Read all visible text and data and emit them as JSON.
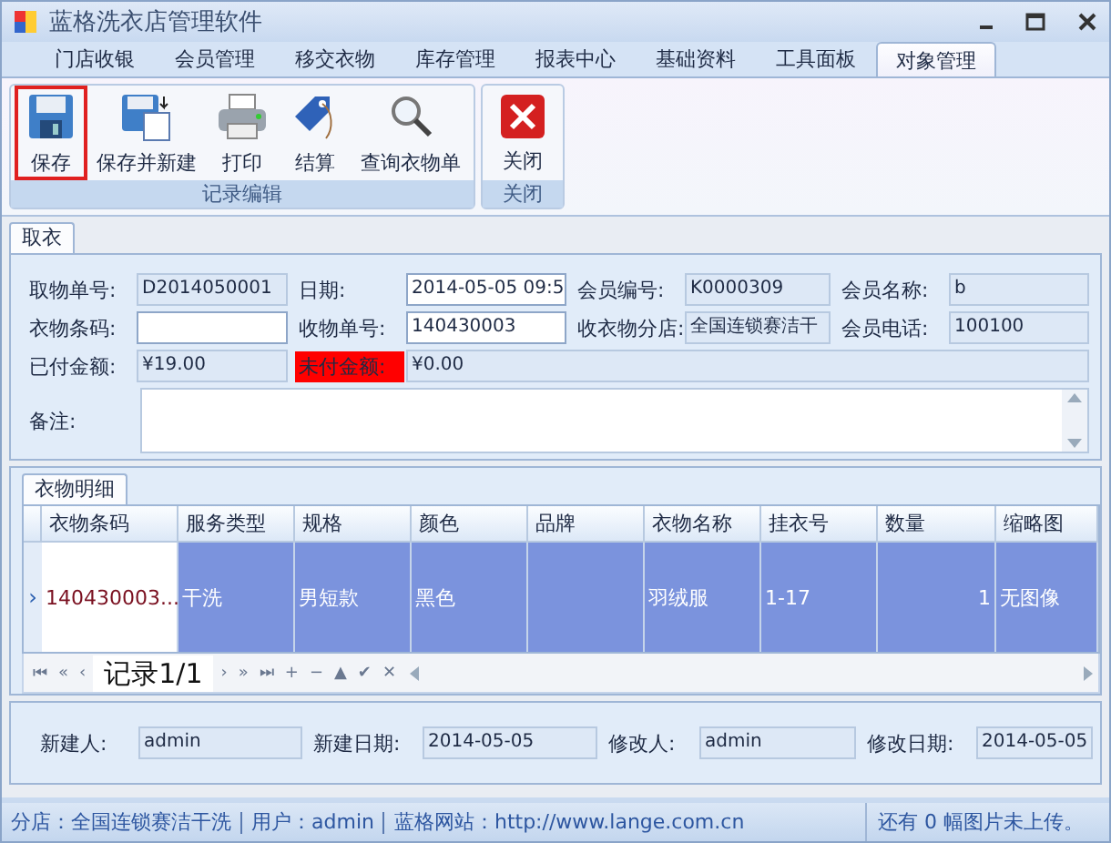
{
  "window": {
    "title": "蓝格洗衣店管理软件"
  },
  "ribbon": {
    "tabs": [
      {
        "label": "门店收银",
        "selected": false
      },
      {
        "label": "会员管理",
        "selected": false
      },
      {
        "label": "移交衣物",
        "selected": false
      },
      {
        "label": "库存管理",
        "selected": false
      },
      {
        "label": "报表中心",
        "selected": false
      },
      {
        "label": "基础资料",
        "selected": false
      },
      {
        "label": "工具面板",
        "selected": false
      },
      {
        "label": "对象管理",
        "selected": true
      }
    ],
    "groups": [
      {
        "label": "记录编辑",
        "buttons": [
          {
            "label": "保存",
            "kind": "floppy",
            "highlighted": true
          },
          {
            "label": "保存并新建",
            "kind": "floppy-new",
            "highlighted": false
          },
          {
            "label": "打印",
            "kind": "printer",
            "highlighted": false
          },
          {
            "label": "结算",
            "kind": "tag",
            "highlighted": false
          },
          {
            "label": "查询衣物单",
            "kind": "magnifier",
            "highlighted": false
          }
        ]
      },
      {
        "label": "关闭",
        "buttons": [
          {
            "label": "关闭",
            "kind": "close",
            "highlighted": false
          }
        ]
      }
    ]
  },
  "form": {
    "tab": "取衣",
    "rows": [
      {
        "cells": [
          {
            "kind": "label",
            "text": "取物单号:"
          },
          {
            "kind": "field",
            "value": "D2014050001",
            "editable": false
          },
          {
            "kind": "label",
            "text": "日期:"
          },
          {
            "kind": "dropdown",
            "value": "2014-05-05 09:5",
            "editable": true
          },
          {
            "kind": "label",
            "text": "会员编号:"
          },
          {
            "kind": "field",
            "value": "K0000309",
            "editable": false
          },
          {
            "kind": "label",
            "text": "会员名称:"
          },
          {
            "kind": "field",
            "value": "b",
            "editable": false
          }
        ]
      },
      {
        "cells": [
          {
            "kind": "label",
            "text": "衣物条码:"
          },
          {
            "kind": "field",
            "editable": true
          },
          {
            "kind": "label",
            "text": "收物单号:"
          },
          {
            "kind": "field",
            "value": "140430003",
            "editable": true
          },
          {
            "kind": "label",
            "text": "收衣物分店:"
          },
          {
            "kind": "field",
            "value": "全国连锁赛洁干",
            "editable": false
          },
          {
            "kind": "label",
            "text": "会员电话:"
          },
          {
            "kind": "field",
            "value": "100100",
            "editable": false
          }
        ]
      },
      {
        "cells": [
          {
            "kind": "label",
            "text": "已付金额:"
          },
          {
            "kind": "field",
            "value": "¥19.00",
            "editable": false
          },
          {
            "kind": "alert-label",
            "text": "未付金额:"
          },
          {
            "kind": "field",
            "value": "¥0.00",
            "editable": false
          }
        ]
      }
    ],
    "remark": {
      "label": "备注:"
    }
  },
  "details": {
    "tab": "衣物明细",
    "columns": [
      "衣物条码",
      "服务类型",
      "规格",
      "颜色",
      "品牌",
      "衣物名称",
      "挂衣号",
      "数量",
      "缩略图"
    ],
    "rows": [
      {
        "indicator": "›",
        "selected": true,
        "cells": [
          "140430003...",
          "干洗",
          "男短款",
          "黑色",
          "",
          "羽绒服",
          "1-17",
          "1",
          "无图像"
        ]
      }
    ],
    "navigator": {
      "buttons": [
        "⏮",
        "«",
        "‹",
        "›",
        "»",
        "⏭",
        "+",
        "−",
        "▲",
        "✔",
        "✕"
      ],
      "record": "记录1/1"
    }
  },
  "audit": [
    {
      "label": "新建人:",
      "value": "admin"
    },
    {
      "label": "新建日期:",
      "value": "2014-05-05"
    },
    {
      "label": "修改人:",
      "value": "admin"
    },
    {
      "label": "修改日期:",
      "value": "2014-05-05"
    }
  ],
  "status_bar": {
    "items": [
      "分店：全国连锁赛洁干洗",
      "用户：admin",
      "蓝格网站：http://www.lange.com.cn"
    ],
    "right": "还有 0 幅图片未上传。"
  }
}
